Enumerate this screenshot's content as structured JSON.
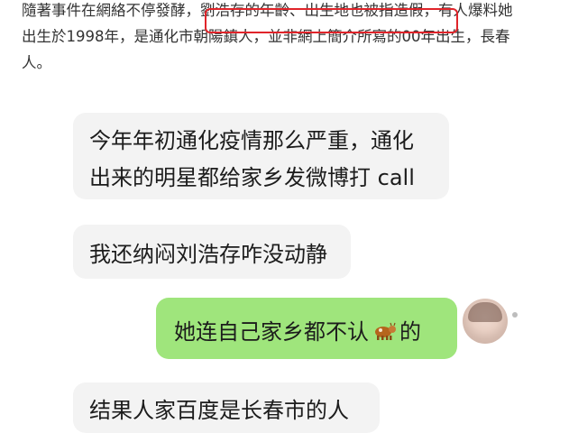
{
  "article": {
    "line1_before": "隨著事件在網絡不停發酵，",
    "line1_highlight": "劉浩存的年齡、出生地也被指造假",
    "line1_after": "，有人爆料她",
    "line2": "出生於1998年，是通化市朝陽鎮人，並非網上簡介所寫的00年出生，長春",
    "line3": "人。"
  },
  "chat": {
    "messages": [
      {
        "side": "left",
        "lines": [
          "今年年初通化疫情那么严重，通化",
          "出来的明星都给家乡发微博打 call"
        ]
      },
      {
        "side": "left",
        "lines": [
          "我还纳闷刘浩存咋没动静"
        ]
      },
      {
        "side": "right",
        "before_icon": "她连自己家乡都不认",
        "icon": "cow-icon",
        "after_icon": "的"
      },
      {
        "side": "left",
        "lines": [
          "结果人家百度是长春市的人"
        ]
      }
    ]
  },
  "colors": {
    "highlight_border": "#e0242a",
    "bubble_left": "#f3f3f3",
    "bubble_right": "#9fe57c",
    "article_text": "#333333"
  }
}
